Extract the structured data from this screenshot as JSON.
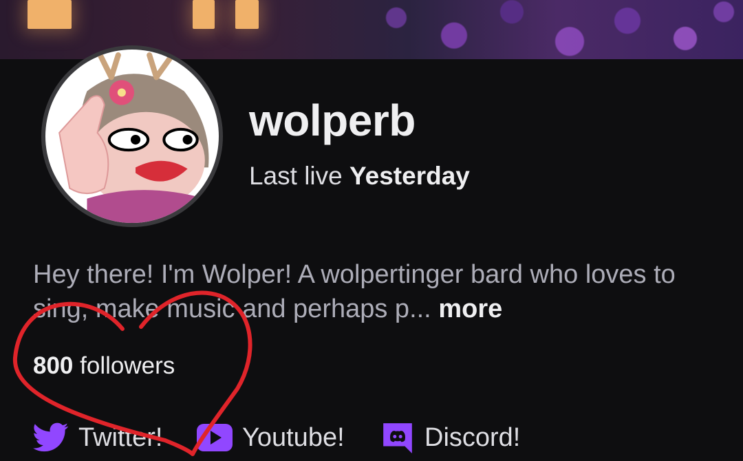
{
  "profile": {
    "username": "wolperb",
    "last_live_prefix": "Last live",
    "last_live_value": "Yesterday"
  },
  "bio": {
    "text": "Hey there! I'm Wolper! A wolpertinger bard who loves to sing, make music and perhaps p...",
    "more_label": "more"
  },
  "stats": {
    "followers_count": "800",
    "followers_label": "followers"
  },
  "links": [
    {
      "label": "Twitter!",
      "icon": "twitter-bird-icon"
    },
    {
      "label": "Youtube!",
      "icon": "youtube-play-icon"
    },
    {
      "label": "Discord!",
      "icon": "discord-icon"
    }
  ],
  "colors": {
    "background": "#0e0e10",
    "accent_purple": "#9147ff",
    "annotation_red": "#e0242a"
  }
}
